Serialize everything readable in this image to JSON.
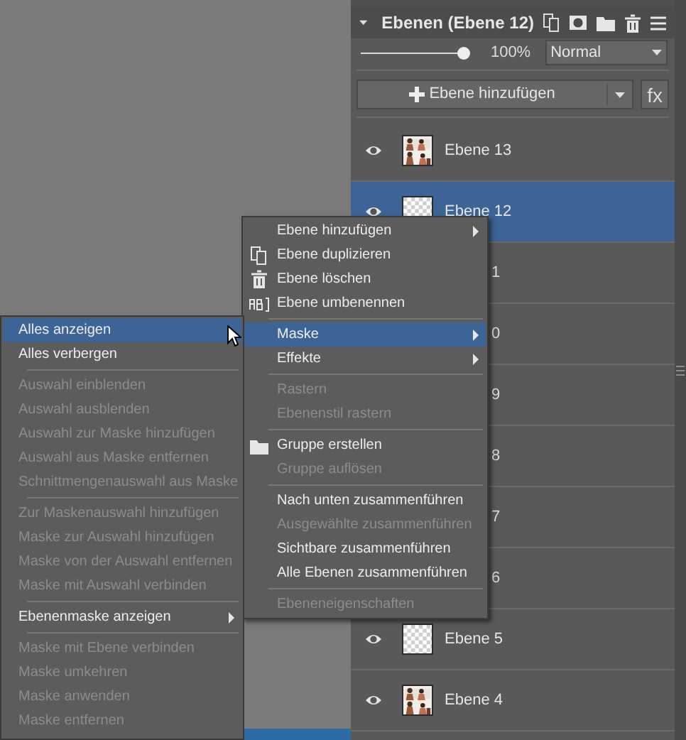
{
  "panel": {
    "title": "Ebenen (Ebene 12)",
    "expanded": true,
    "opacity": {
      "level": 1,
      "reading": "100%"
    },
    "blend_mode": "Normal",
    "add_button": "Ebene hinzufügen",
    "fx_button": "fx"
  },
  "layers": [
    {
      "kind": "photo_layer",
      "name": "Ebene 13",
      "visible": true,
      "selected": false
    },
    {
      "kind": "empty_layer",
      "name": "Ebene 12",
      "visible": true,
      "selected": true
    },
    {
      "kind": "covered",
      "name": "1",
      "selected": false
    },
    {
      "kind": "covered",
      "name": "0",
      "selected": false
    },
    {
      "kind": "covered",
      "name": "9",
      "selected": false
    },
    {
      "kind": "covered",
      "name": "8",
      "selected": false
    },
    {
      "kind": "covered",
      "name": "7",
      "selected": false
    },
    {
      "kind": "covered",
      "name": "6",
      "selected": false
    },
    {
      "kind": "empty_layer",
      "name": "Ebene 5",
      "visible": true,
      "selected": false
    },
    {
      "kind": "photo_layer",
      "name": "Ebene 4",
      "visible": true,
      "selected": false
    }
  ],
  "context_menu": {
    "items": [
      {
        "kind": "item",
        "label": "Ebene hinzufügen",
        "disabled": false,
        "selected": false,
        "submenu": true
      },
      {
        "kind": "item",
        "label": "Ebene duplizieren",
        "disabled": false,
        "selected": false,
        "submenu": false
      },
      {
        "kind": "item",
        "label": "Ebene löschen",
        "disabled": false,
        "selected": false,
        "submenu": false
      },
      {
        "kind": "item",
        "label": "Ebene umbenennen",
        "disabled": false,
        "selected": false,
        "submenu": false
      },
      {
        "kind": "separator"
      },
      {
        "kind": "item",
        "label": "Maske",
        "disabled": false,
        "selected": true,
        "submenu": true
      },
      {
        "kind": "item",
        "label": "Effekte",
        "disabled": false,
        "selected": false,
        "submenu": true
      },
      {
        "kind": "separator"
      },
      {
        "kind": "item",
        "label": "Rastern",
        "disabled": true,
        "selected": false,
        "submenu": false
      },
      {
        "kind": "item",
        "label": "Ebenenstil rastern",
        "disabled": true,
        "selected": false,
        "submenu": false
      },
      {
        "kind": "separator"
      },
      {
        "kind": "item",
        "label": "Gruppe erstellen",
        "disabled": false,
        "selected": false,
        "submenu": false
      },
      {
        "kind": "item",
        "label": "Gruppe auflösen",
        "disabled": true,
        "selected": false,
        "submenu": false
      },
      {
        "kind": "separator"
      },
      {
        "kind": "item",
        "label": "Nach unten zusammenführen",
        "disabled": false,
        "selected": false,
        "submenu": false
      },
      {
        "kind": "item",
        "label": "Ausgewählte zusammenführen",
        "disabled": true,
        "selected": false,
        "submenu": false
      },
      {
        "kind": "item",
        "label": "Sichtbare zusammenführen",
        "disabled": false,
        "selected": false,
        "submenu": false
      },
      {
        "kind": "item",
        "label": "Alle Ebenen zusammenführen",
        "disabled": false,
        "selected": false,
        "submenu": false
      },
      {
        "kind": "separator"
      },
      {
        "kind": "item",
        "label": "Ebeneneigenschaften",
        "disabled": true,
        "selected": false,
        "submenu": false
      }
    ]
  },
  "submenu": {
    "items": [
      {
        "kind": "item",
        "label": "Alles anzeigen",
        "disabled": false,
        "selected": true,
        "submenu": false
      },
      {
        "kind": "item",
        "label": "Alles verbergen",
        "disabled": false,
        "selected": false,
        "submenu": false
      },
      {
        "kind": "separator"
      },
      {
        "kind": "item",
        "label": "Auswahl einblenden",
        "disabled": true,
        "selected": false,
        "submenu": false
      },
      {
        "kind": "item",
        "label": "Auswahl ausblenden",
        "disabled": true,
        "selected": false,
        "submenu": false
      },
      {
        "kind": "item",
        "label": "Auswahl zur Maske hinzufügen",
        "disabled": true,
        "selected": false,
        "submenu": false
      },
      {
        "kind": "item",
        "label": "Auswahl aus Maske entfernen",
        "disabled": true,
        "selected": false,
        "submenu": false
      },
      {
        "kind": "item",
        "label": "Schnittmengenauswahl aus Maske",
        "disabled": true,
        "selected": false,
        "submenu": false
      },
      {
        "kind": "separator"
      },
      {
        "kind": "item",
        "label": "Zur Maskenauswahl hinzufügen",
        "disabled": true,
        "selected": false,
        "submenu": false
      },
      {
        "kind": "item",
        "label": "Maske zur Auswahl hinzufügen",
        "disabled": true,
        "selected": false,
        "submenu": false
      },
      {
        "kind": "item",
        "label": "Maske von der Auswahl entfernen",
        "disabled": true,
        "selected": false,
        "submenu": false
      },
      {
        "kind": "item",
        "label": "Maske mit Auswahl verbinden",
        "disabled": true,
        "selected": false,
        "submenu": false
      },
      {
        "kind": "separator"
      },
      {
        "kind": "item",
        "label": "Ebenenmaske anzeigen",
        "disabled": false,
        "selected": false,
        "submenu": true
      },
      {
        "kind": "separator"
      },
      {
        "kind": "item",
        "label": "Maske mit Ebene verbinden",
        "disabled": true,
        "selected": false,
        "submenu": false
      },
      {
        "kind": "item",
        "label": "Maske umkehren",
        "disabled": true,
        "selected": false,
        "submenu": false
      },
      {
        "kind": "item",
        "label": "Maske anwenden",
        "disabled": true,
        "selected": false,
        "submenu": false
      },
      {
        "kind": "item",
        "label": "Maske entfernen",
        "disabled": true,
        "selected": false,
        "submenu": false
      }
    ]
  }
}
